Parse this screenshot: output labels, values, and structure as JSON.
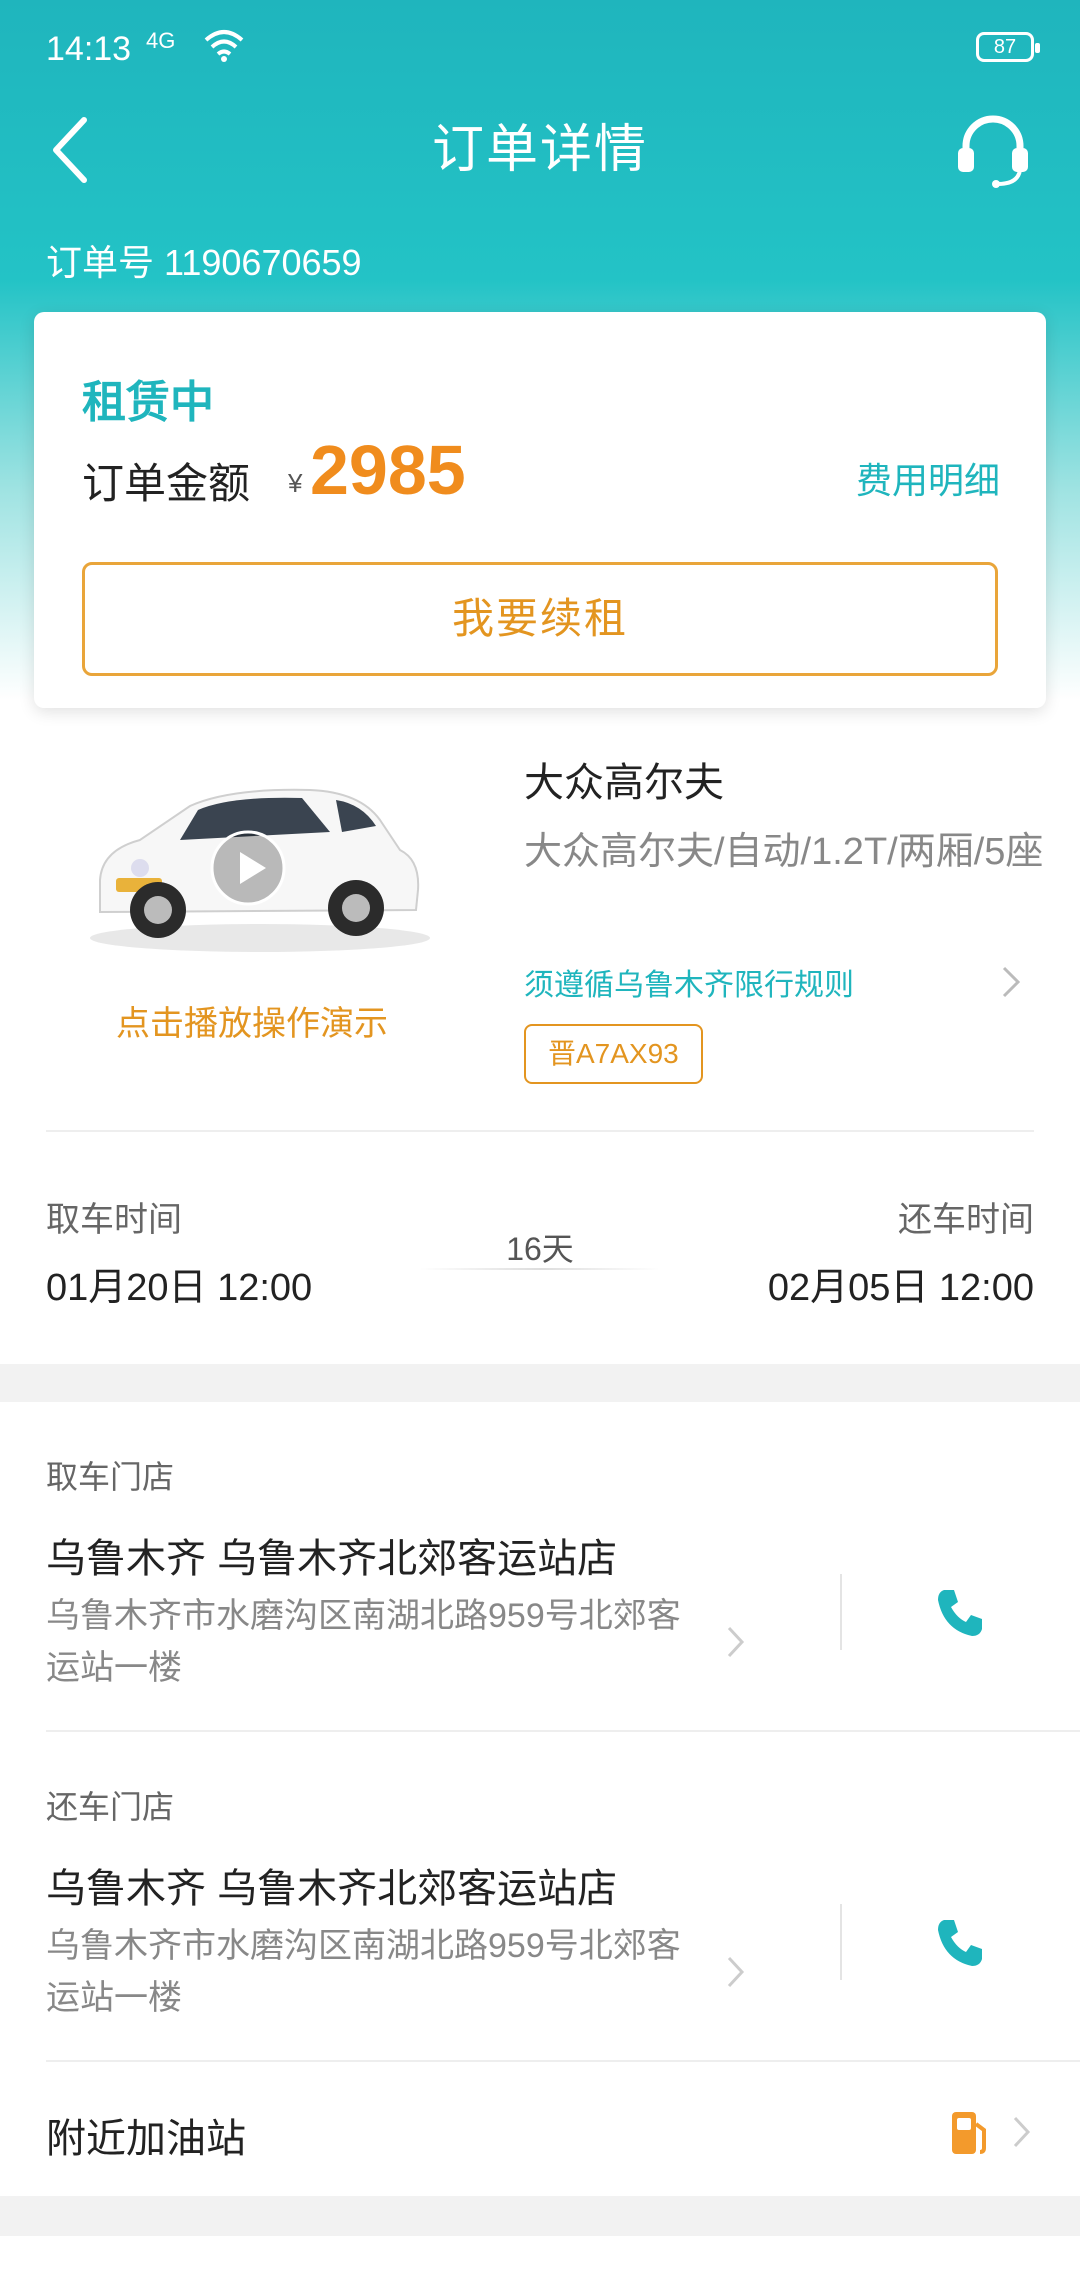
{
  "status_bar": {
    "time": "14:13",
    "signal": "4G",
    "battery": "87"
  },
  "header": {
    "title": "订单详情",
    "order_no": "订单号 1190670659"
  },
  "order_card": {
    "status": "租赁中",
    "amount_label": "订单金额",
    "currency": "¥",
    "amount": "2985",
    "fee_detail": "费用明细",
    "renew_button": "我要续租"
  },
  "car": {
    "demo_link": "点击播放操作演示",
    "name": "大众高尔夫",
    "spec": "大众高尔夫/自动/1.2T/两厢/5座",
    "limit_rule": "须遵循乌鲁木齐限行规则",
    "plate": "晋A7AX93",
    "color": "#ffffff"
  },
  "rental_period": {
    "pickup_label": "取车时间",
    "pickup_time": "01月20日 12:00",
    "duration": "16天",
    "return_label": "还车时间",
    "return_time": "02月05日 12:00"
  },
  "pickup_store": {
    "label": "取车门店",
    "name": "乌鲁木齐 乌鲁木齐北郊客运站店",
    "address": "乌鲁木齐市水磨沟区南湖北路959号北郊客运站一楼"
  },
  "return_store": {
    "label": "还车门店",
    "name": "乌鲁木齐 乌鲁木齐北郊客运站店",
    "address": "乌鲁木齐市水磨沟区南湖北路959号北郊客运站一楼"
  },
  "nearby": {
    "gas_station": "附近加油站"
  },
  "icons": {
    "back": "back-arrow-icon",
    "service": "headset-icon",
    "play": "play-icon",
    "phone": "phone-icon",
    "fuel": "fuel-pump-icon",
    "chevron": "chevron-right-icon"
  },
  "colors": {
    "accent": "#1fb5bd",
    "orange": "#f08c1d",
    "renew_border": "#e9a53a"
  }
}
